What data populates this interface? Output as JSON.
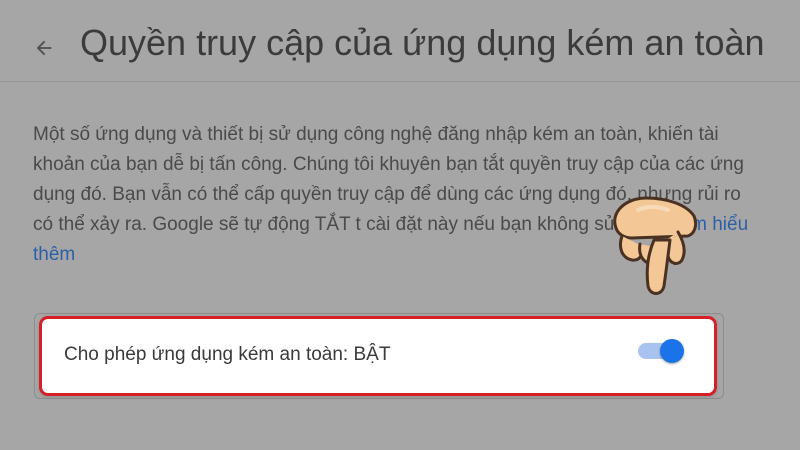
{
  "header": {
    "back_icon": "arrow-back-icon",
    "title": "Quyền truy cập của ứng dụng kém an toàn"
  },
  "description": {
    "text": "Một số ứng dụng và thiết bị sử dụng công nghệ đăng nhập kém an toàn, khiến tài khoản của bạn dễ bị tấn công. Chúng tôi khuyên bạn tắt quyền truy cập của các ứng dụng đó. Bạn vẫn có thể cấp quyền truy cập để dùng các ứng dụng đó, nhưng rủi ro có thể xảy ra. Google sẽ tự động TẮT t cài đặt này nếu bạn không sử dụng.",
    "link_text": "Tìm hiểu thêm"
  },
  "setting": {
    "label": "Cho phép ứng dụng kém an toàn: BẬT",
    "toggle_on": true
  },
  "overlay": {
    "pointer_icon": "pointing-hand-icon",
    "highlight_color": "#d42026"
  },
  "colors": {
    "background": "#a6a6a6",
    "link": "#2d5fa6",
    "toggle_knob": "#1a73e8",
    "toggle_track": "#a8c3f0"
  }
}
